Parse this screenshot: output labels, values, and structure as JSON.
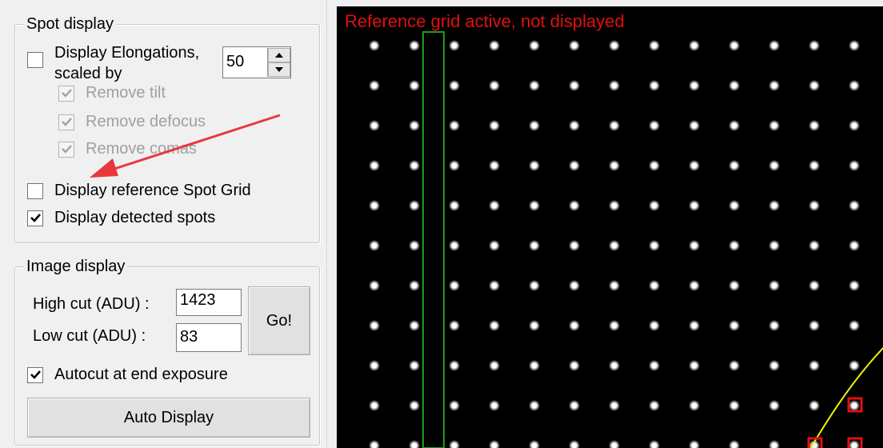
{
  "spot_display": {
    "title": "Spot display",
    "elongations": {
      "label_line1": "Display Elongations,",
      "label_line2": "scaled by",
      "checked": false,
      "scale": "50"
    },
    "sub_options": [
      {
        "label": "Remove tilt",
        "checked": true,
        "enabled": false
      },
      {
        "label": "Remove defocus",
        "checked": true,
        "enabled": false
      },
      {
        "label": "Remove comas",
        "checked": true,
        "enabled": false
      }
    ],
    "reference_grid": {
      "label": "Display reference Spot Grid",
      "checked": false
    },
    "detected_spots": {
      "label": "Display detected spots",
      "checked": true
    }
  },
  "image_display": {
    "title": "Image display",
    "high_cut_label": "High cut (ADU) :",
    "high_cut_value": "1423",
    "low_cut_label": "Low cut (ADU) :",
    "low_cut_value": "83",
    "go_button": "Go!",
    "autocut": {
      "label": "Autocut at end exposure",
      "checked": true
    },
    "auto_display_button": "Auto Display"
  },
  "image_view": {
    "banner": "Reference grid active, not displayed",
    "banner_color": "#e01010",
    "background_color": "#000000",
    "spot_color": "#ffffff",
    "highlight_rect_color": "#1f9a1f",
    "curve_color": "#f2f20a",
    "marker_color": "#e01010"
  },
  "annotation": {
    "arrow_color": "#e8383d"
  }
}
